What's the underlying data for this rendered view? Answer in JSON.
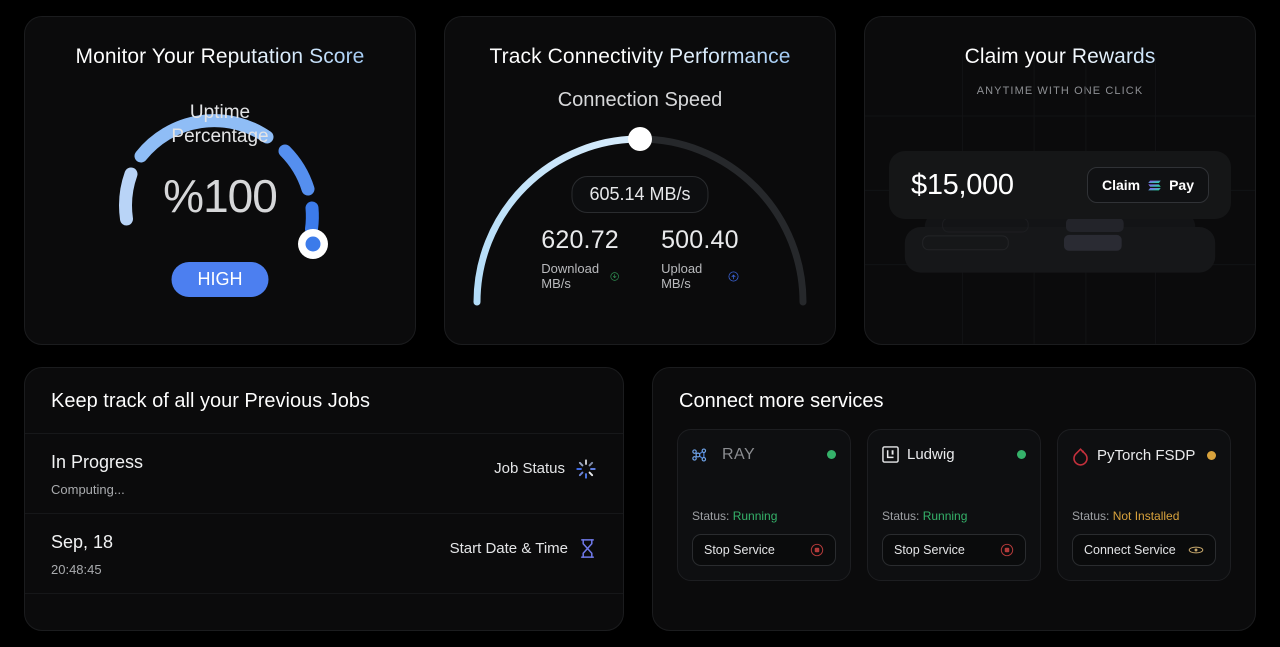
{
  "theme": {
    "bg": "#000000",
    "card_bg": "#0b0b0c",
    "accent_blue": "#4c7ff0",
    "accent_light_blue": "#a8c8f5",
    "green": "#35b26a",
    "amber": "#d8a23c",
    "red": "#c0392b"
  },
  "reputation": {
    "title": "Monitor Your Reputation Score",
    "gauge_label_line1": "Uptime",
    "gauge_label_line2": "Percentage",
    "value": "%100",
    "badge": "HIGH",
    "icon_knob": "gauge-knob-icon"
  },
  "connectivity": {
    "title": "Track Connectivity Performance",
    "subtitle": "Connection Speed",
    "current_speed": "605.14 MB/s",
    "stats": [
      {
        "value": "620.72",
        "label": "Download MB/s",
        "icon": "download-circle-icon",
        "icon_color": "#2f8f52"
      },
      {
        "value": "500.40",
        "label": "Upload MB/s",
        "icon": "upload-circle-icon",
        "icon_color": "#3b63d6"
      }
    ]
  },
  "rewards": {
    "title": "Claim your Rewards",
    "eyebrow": "ANYTIME WITH ONE CLICK",
    "amount": "$15,000",
    "button_label_left": "Claim",
    "button_label_right": "Pay",
    "button_icon": "solana-pay-icon"
  },
  "jobs": {
    "title": "Keep track of all your Previous Jobs",
    "rows": [
      {
        "primary": "In Progress",
        "secondary": "Computing...",
        "right_label": "Job Status",
        "right_icon": "spinner-icon"
      },
      {
        "primary": "Sep, 18",
        "secondary": "20:48:45",
        "right_label": "Start Date & Time",
        "right_icon": "hourglass-icon"
      }
    ]
  },
  "services": {
    "title": "Connect more services",
    "status_prefix": "Status:",
    "items": [
      {
        "name": "RAY",
        "icon": "ray-logo-icon",
        "dot_color": "#35b26a",
        "status": "Running",
        "status_color": "#35b26a",
        "button_label": "Stop Service",
        "button_icon": "stop-circle-icon",
        "button_icon_color": "#b33a3a"
      },
      {
        "name": "Ludwig",
        "icon": "ludwig-logo-icon",
        "dot_color": "#35b26a",
        "status": "Running",
        "status_color": "#35b26a",
        "button_label": "Stop Service",
        "button_icon": "stop-circle-icon",
        "button_icon_color": "#b33a3a"
      },
      {
        "name": "PyTorch FSDP",
        "icon": "pytorch-logo-icon",
        "dot_color": "#d8a23c",
        "status": "Not Installed",
        "status_color": "#d8a23c",
        "button_label": "Connect Service",
        "button_icon": "link-icon",
        "button_icon_color": "#c8a96d"
      }
    ]
  }
}
